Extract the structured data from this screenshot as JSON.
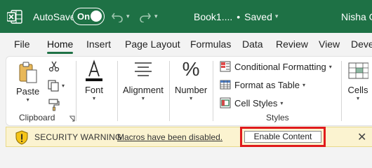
{
  "titlebar": {
    "autosave_label": "AutoSave",
    "toggle_state": "On",
    "filename": "Book1....",
    "save_status": "Saved",
    "username": "Nisha G",
    "bg_color": "#1e7145"
  },
  "tabs": [
    {
      "label": "File"
    },
    {
      "label": "Home",
      "active": true
    },
    {
      "label": "Insert"
    },
    {
      "label": "Page Layout"
    },
    {
      "label": "Formulas"
    },
    {
      "label": "Data"
    },
    {
      "label": "Review"
    },
    {
      "label": "View"
    },
    {
      "label": "Deve"
    }
  ],
  "ribbon": {
    "clipboard": {
      "paste_label": "Paste",
      "group_label": "Clipboard"
    },
    "font": {
      "label": "Font"
    },
    "alignment": {
      "label": "Alignment"
    },
    "number": {
      "label": "Number"
    },
    "styles": {
      "conditional_formatting": "Conditional Formatting",
      "format_as_table": "Format as Table",
      "cell_styles": "Cell Styles",
      "group_label": "Styles"
    },
    "cells": {
      "label": "Cells"
    }
  },
  "security_bar": {
    "title": "SECURITY WARNING",
    "message": "Macros have been disabled.",
    "enable_button": "Enable Content",
    "close_glyph": "✕",
    "highlight_color": "#e01b1b"
  }
}
